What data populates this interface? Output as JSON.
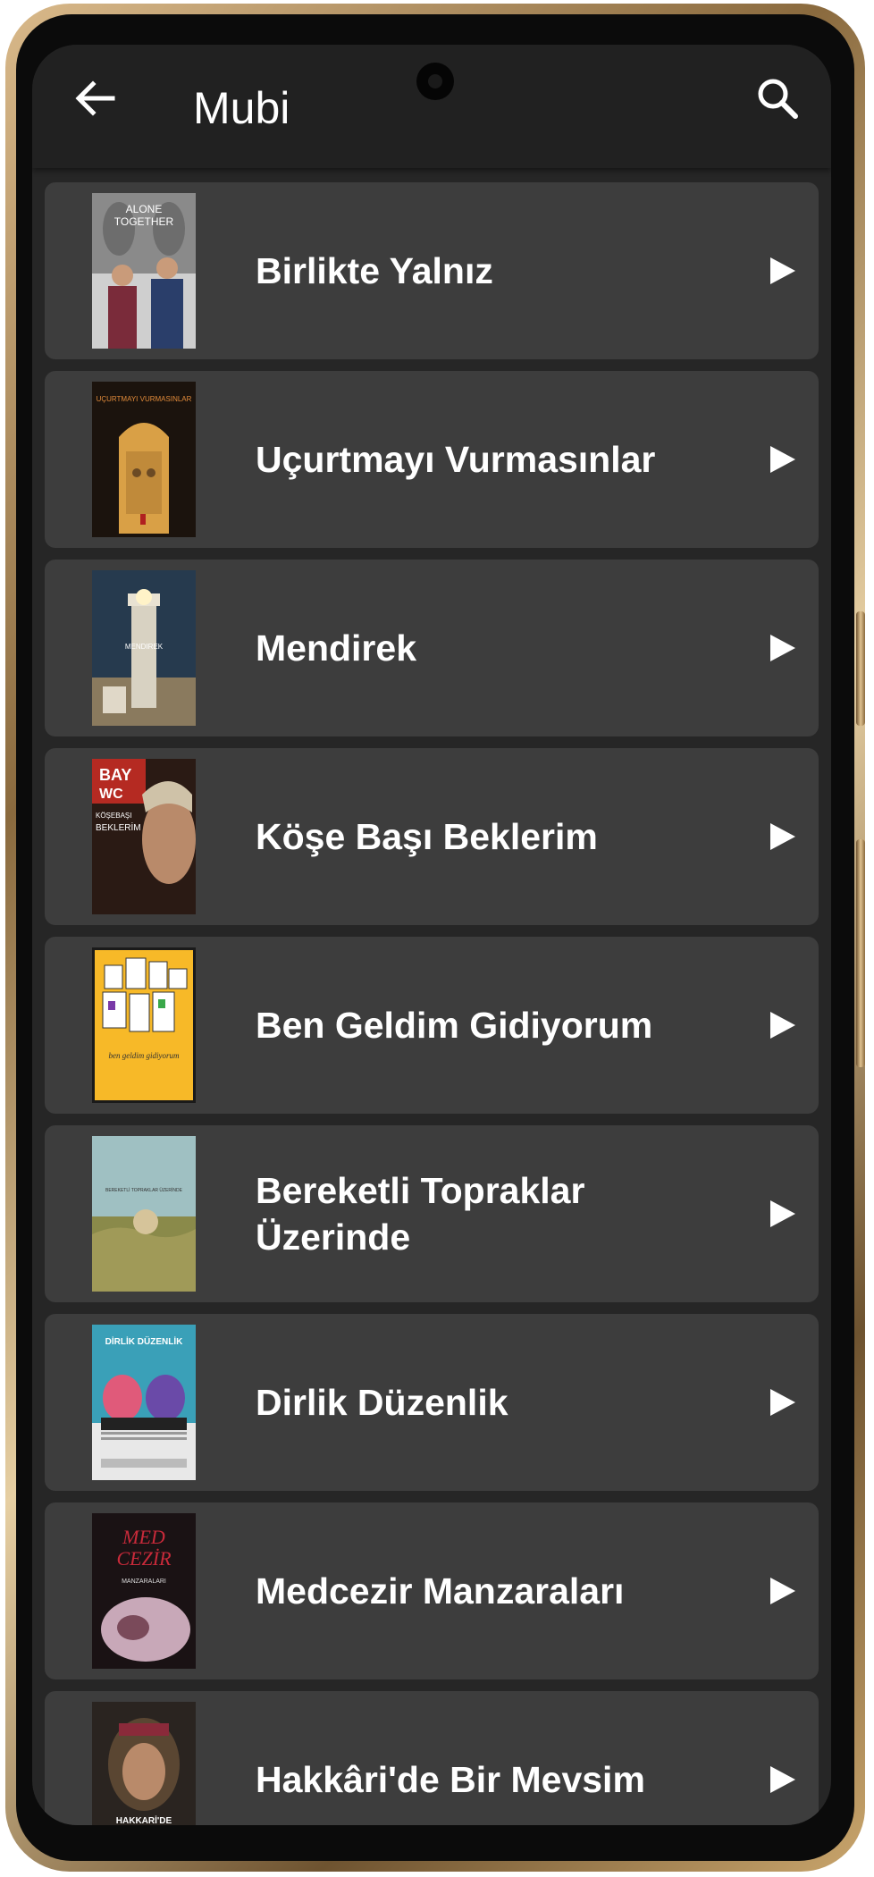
{
  "app_bar": {
    "title": "Mubi",
    "back_icon": "arrow-back-icon",
    "search_icon": "search-icon"
  },
  "movies": [
    {
      "title": "Birlikte Yalnız",
      "poster_text": "ALONE TOGETHER"
    },
    {
      "title": "Uçurtmayı Vurmasınlar",
      "poster_text": "UÇURTMAYI VURMASINLAR"
    },
    {
      "title": "Mendirek",
      "poster_text": "MENDIREK"
    },
    {
      "title": "Köşe Başı Beklerim",
      "poster_text": "BAY WC KÖŞEBAŞI BEKLERİM"
    },
    {
      "title": "Ben Geldim Gidiyorum",
      "poster_text": "ben geldim gidiyorum"
    },
    {
      "title": "Bereketli Topraklar Üzerinde",
      "poster_text": "BEREKETLİ TOPRAKLAR ÜZERİNDE"
    },
    {
      "title": "Dirlik Düzenlik",
      "poster_text": "DİRLİK DÜZENLİK"
    },
    {
      "title": "Medcezir Manzaraları",
      "poster_text": "MEDCEZİR MANZARALARI"
    },
    {
      "title": "Hakkâri'de Bir Mevsim",
      "poster_text": "HAKKARİ'DE BİR MEVSİM"
    }
  ],
  "colors": {
    "app_bar": "#212121",
    "background": "#262626",
    "card": "#3d3d3d",
    "text": "#ffffff"
  }
}
